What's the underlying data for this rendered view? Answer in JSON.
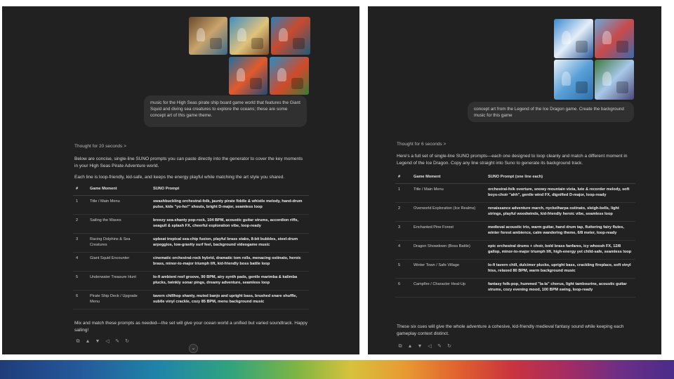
{
  "left": {
    "user_message": "music for the High Seas pirate ship board game world that features the Giant Squid and diving sea creatures to explore the oceans; these are some concept art of this game theme.",
    "thought": "Thought for 20 seconds  >",
    "intro": "Below are concise, single-line SUNO prompts you can paste directly into the generator to cover the key moments in your High Seas Pirate Adventure world.",
    "intro2": "Each line is loop-friendly, kid-safe, and keeps the energy playful while matching the art style you shared.",
    "headers": [
      "#",
      "Game Moment",
      "SUNO Prompt"
    ],
    "rows": [
      {
        "n": "1",
        "moment": "Title / Main Menu",
        "prompt": "swashbuckling orchestral-folk, jaunty pirate fiddle & whistle melody, hand-drum pulse, kids \"yo-ho!\" shouts, bright D-major, seamless loop"
      },
      {
        "n": "2",
        "moment": "Sailing the Waves",
        "prompt": "breezy sea-shanty pop-rock, 104 BPM, acoustic guitar strums, accordion riffs, seagull & splash FX, cheerful exploration vibe, loop-ready"
      },
      {
        "n": "3",
        "moment": "Racing Dolphins & Sea Creatures",
        "prompt": "upbeat tropical sea-chip fusion, playful brass stabs, 8-bit bubbles, steel-drum arpeggios, low-gravity surf feel, background videogame music"
      },
      {
        "n": "4",
        "moment": "Giant Squid Encounter",
        "prompt": "cinematic orchestral-rock hybrid, dramatic tom rolls, menacing ostinato, heroic brass, minor-to-major triumph lift, kid-friendly boss battle loop"
      },
      {
        "n": "5",
        "moment": "Underwater Treasure Hunt",
        "prompt": "lo-fi ambient reef groove, 90 BPM, airy synth pads, gentle marimba & kalimba plucks, twinkly sonar pings, dreamy adventure, seamless loop"
      },
      {
        "n": "6",
        "moment": "Pirate Ship Deck / Upgrade Menu",
        "prompt": "tavern chillhop shanty, muted banjo and upright bass, brushed snare shuffle, subtle vinyl crackle, cozy 85 BPM, menu background music"
      }
    ],
    "outro": "Mix and match these prompts as needed—the set will give your ocean world a unified but varied soundtrack. Happy sailing!",
    "actions": [
      "copy-icon",
      "thumbs-up-icon",
      "thumbs-down-icon",
      "speaker-icon",
      "edit-icon",
      "regenerate-icon"
    ],
    "scroll_glyph": "⌄"
  },
  "right": {
    "user_message": "concept art from the Legend of the Ice Dragon game. Create the background music for this game",
    "thought": "Thought for 6 seconds  >",
    "intro": "Here's a full set of single-line SUNO prompts—each one designed to loop cleanly and match a different moment in Legend of the Ice Dragon. Copy any line straight into Suno to generate its background track.",
    "headers": [
      "#",
      "Game Moment",
      "SUNO Prompt (one line each)"
    ],
    "rows": [
      {
        "n": "1",
        "moment": "Title / Main Menu",
        "prompt": "orchestral-folk overture, snowy mountain vista, lute & recorder melody, soft boys-choir \"ahh\", gentle wind FX, dignified D-major, loop-ready"
      },
      {
        "n": "2",
        "moment": "Overworld Exploration (Ice Realms)",
        "prompt": "renaissance adventure march, nyckelharpa ostinato, sleigh-bells, light strings, playful woodwinds, kid-friendly heroic vibe, seamless loop"
      },
      {
        "n": "3",
        "moment": "Enchanted Pine Forest",
        "prompt": "medieval acoustic trio, warm guitar, hand drum tap, fluttering fairy flutes, winter forest ambience, calm wandering theme, 6/8 meter, loop-ready"
      },
      {
        "n": "4",
        "moment": "Dragon Showdown (Boss Battle)",
        "prompt": "epic orchestral drums + choir, bold brass fanfares, icy whoosh FX, 12/8 gallop, minor-to-major triumph lift, high-energy yet child-safe, seamless loop"
      },
      {
        "n": "5",
        "moment": "Winter Town / Safe Village",
        "prompt": "lo-fi tavern chill, dulcimer plucks, upright bass, crackling fireplace, soft vinyl hiss, relaxed 80 BPM, warm background music"
      },
      {
        "n": "6",
        "moment": "Campfire / Character Heal-Up",
        "prompt": "fantasy folk-pop, hummed \"la-la\" chorus, light tambourine, acoustic guitar strums, cozy evening mood, 100 BPM swing, loop-ready"
      }
    ],
    "outro": "These six cues will give the whole adventure a cohesive, kid-friendly medieval fantasy sound while keeping each gameplay context distinct.",
    "actions": [
      "copy-icon",
      "thumbs-up-icon",
      "thumbs-down-icon",
      "speaker-icon",
      "edit-icon",
      "regenerate-icon"
    ]
  },
  "icon_glyphs": {
    "copy-icon": "⧉",
    "thumbs-up-icon": "👍",
    "thumbs-down-icon": "👎",
    "speaker-icon": "🔊",
    "edit-icon": "✎",
    "regenerate-icon": "↻"
  },
  "colors": {
    "panel_bg": "#212121",
    "bubble_bg": "#303030",
    "text": "#d8d8d8"
  }
}
